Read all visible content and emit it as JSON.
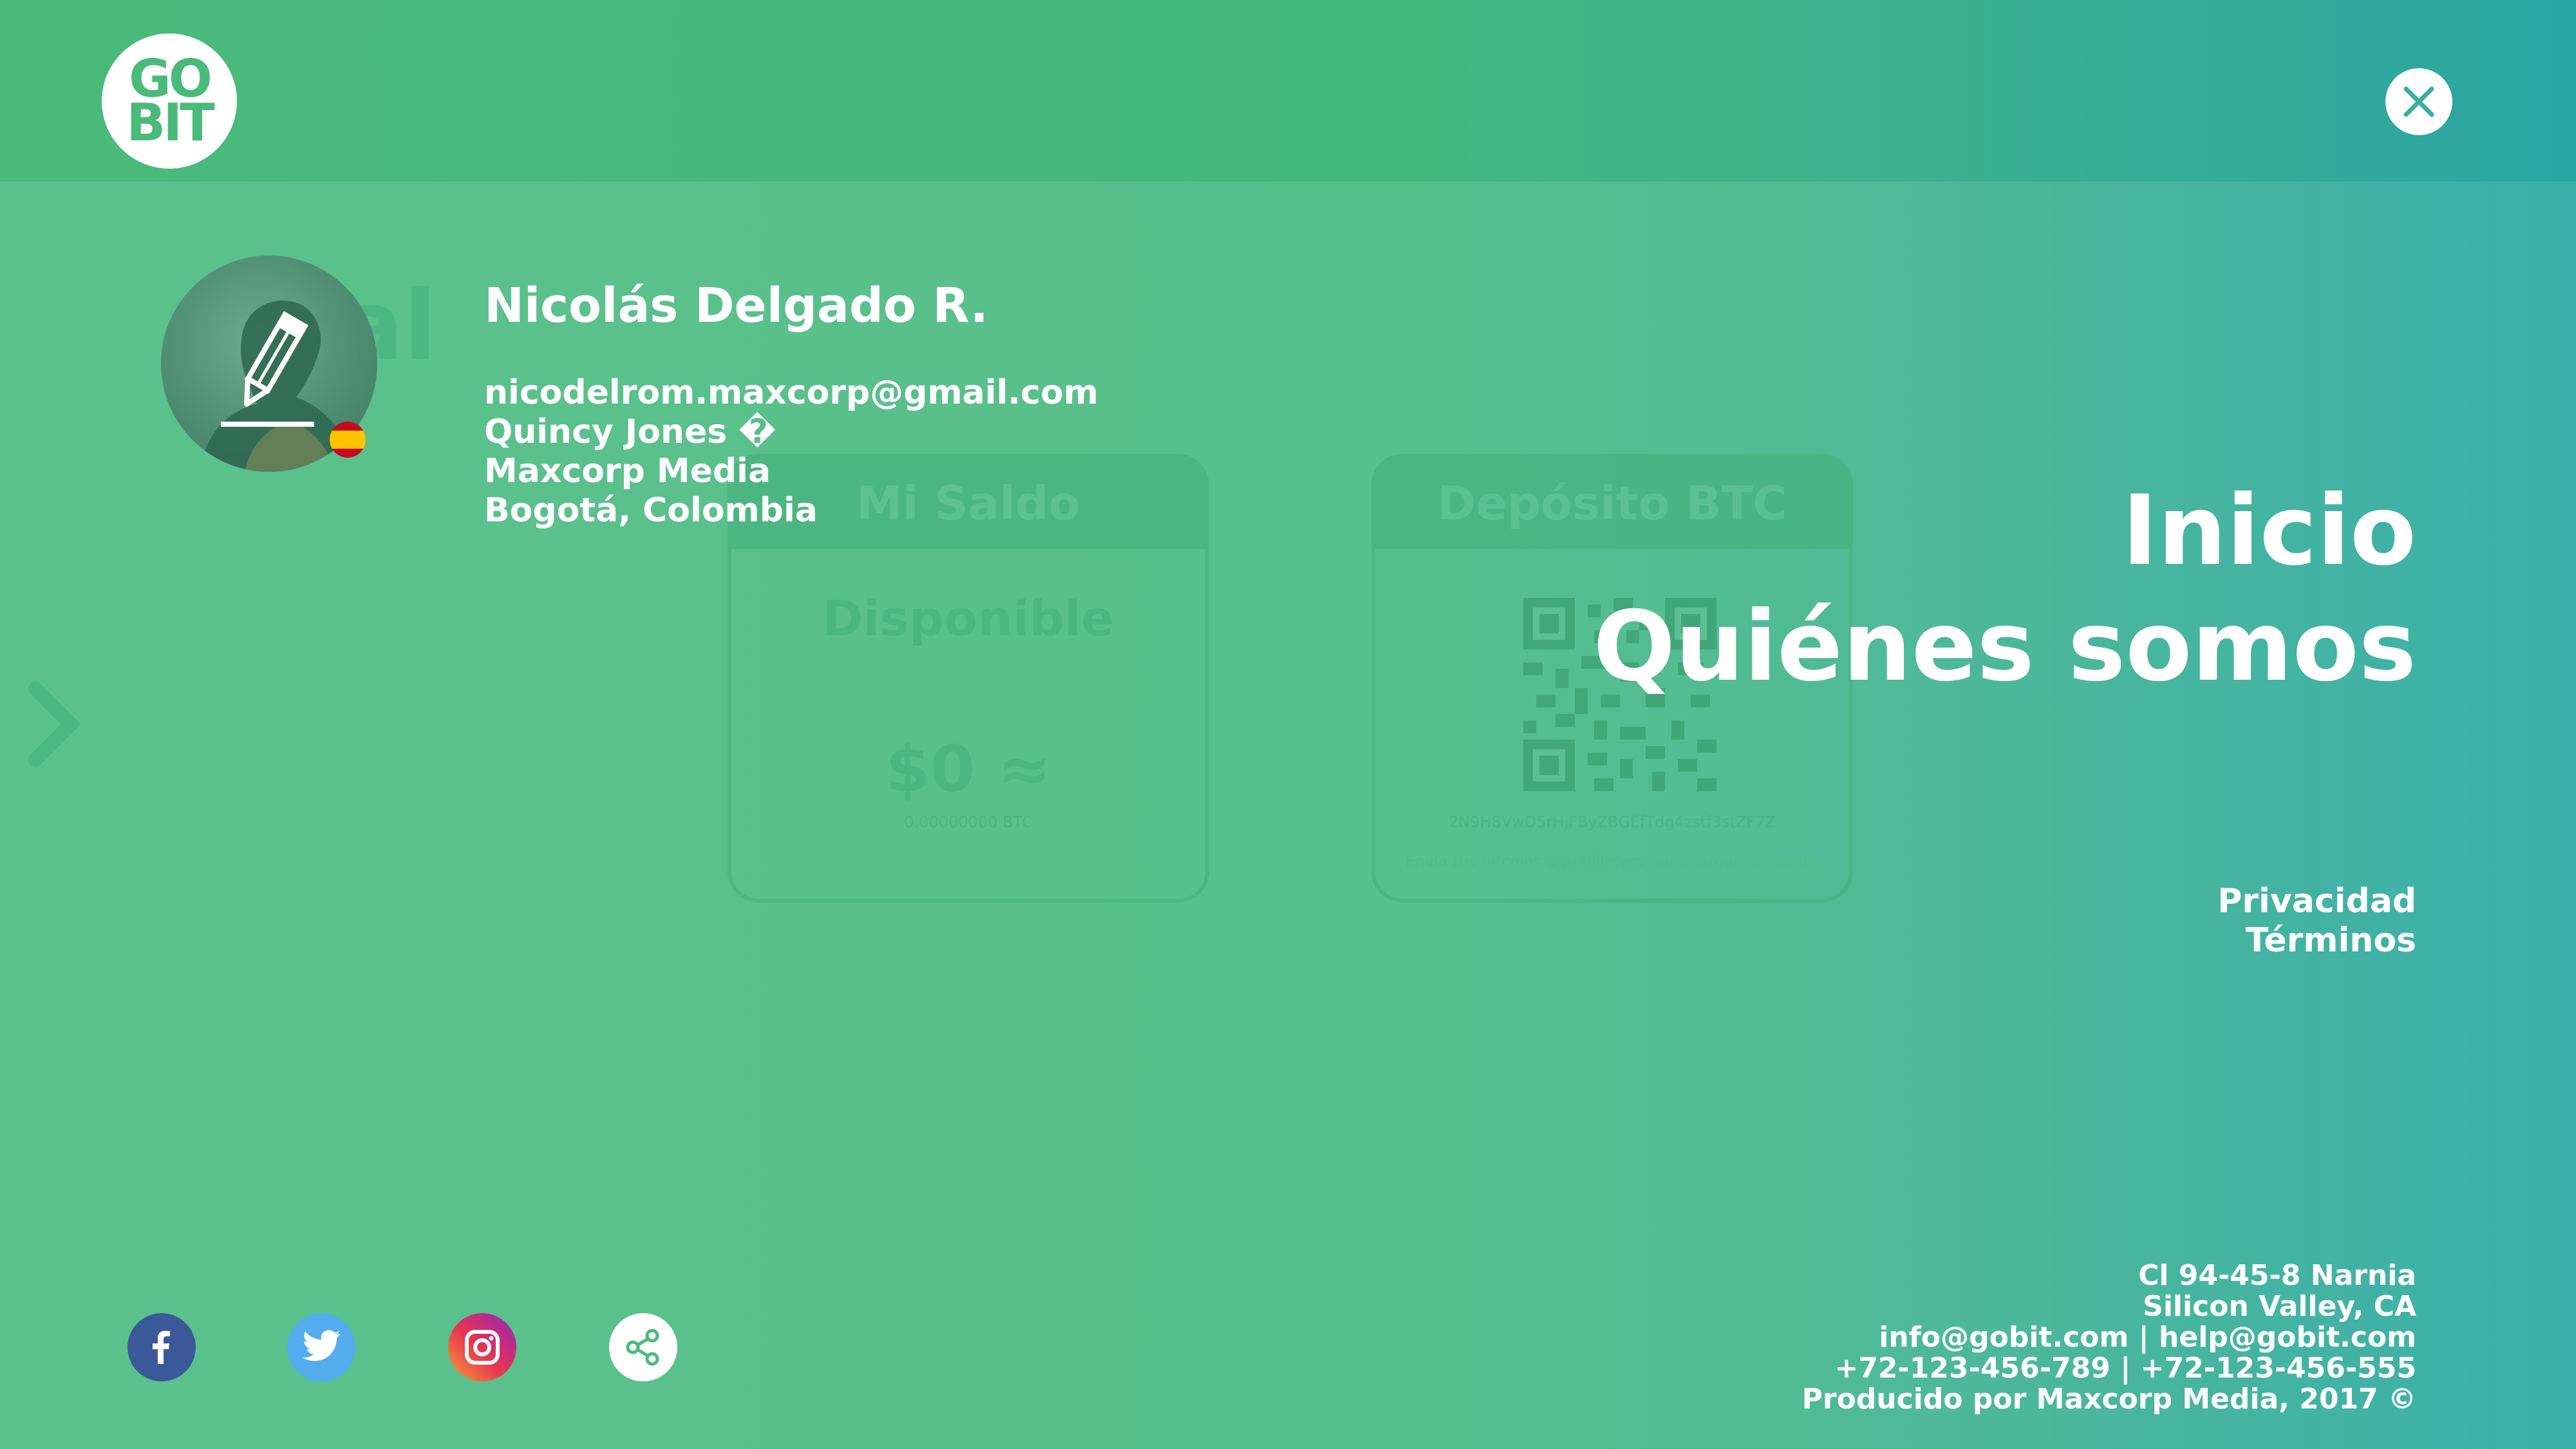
{
  "brand": {
    "logo_line1": "GO",
    "logo_line2": "BIT"
  },
  "background": {
    "title_fragment": "eral",
    "balance_card": {
      "title": "Mi Saldo",
      "label": "Disponible",
      "amount": "$0 ≈",
      "btc": "0.00000000 BTC"
    },
    "deposit_card": {
      "title": "Depósito BTC",
      "address": "2N9H8VwD5rHjFByZBGEfTdg4zstf3stZF7Z",
      "hint": "Envía tus bitcoins a tu billetera para cargar tu cuenta"
    }
  },
  "profile": {
    "name": "Nicolás Delgado R.",
    "email": "nicodelrom.maxcorp@gmail.com",
    "contact": "Quincy Jones �",
    "company": "Maxcorp Media",
    "location": "Bogotá, Colombia",
    "flag": "spain-flag"
  },
  "menu": {
    "items": [
      "Inicio",
      "Quiénes somos"
    ]
  },
  "legal": {
    "privacy": "Privacidad",
    "terms": "Términos"
  },
  "footer": {
    "address1": "Cl 94-45-8 Narnia",
    "address2": "Silicon Valley, CA",
    "emails": "info@gobit.com | help@gobit.com",
    "phones": "+72-123-456-789 | +72-123-456-555",
    "credit": "Producido por Maxcorp Media, 2017 ©"
  },
  "social": [
    "facebook-icon",
    "twitter-icon",
    "instagram-icon",
    "share-icon"
  ],
  "colors": {
    "accent_green": "#4aba7a",
    "teal": "#2aa5a3",
    "facebook": "#3b5999",
    "twitter": "#55acee"
  }
}
